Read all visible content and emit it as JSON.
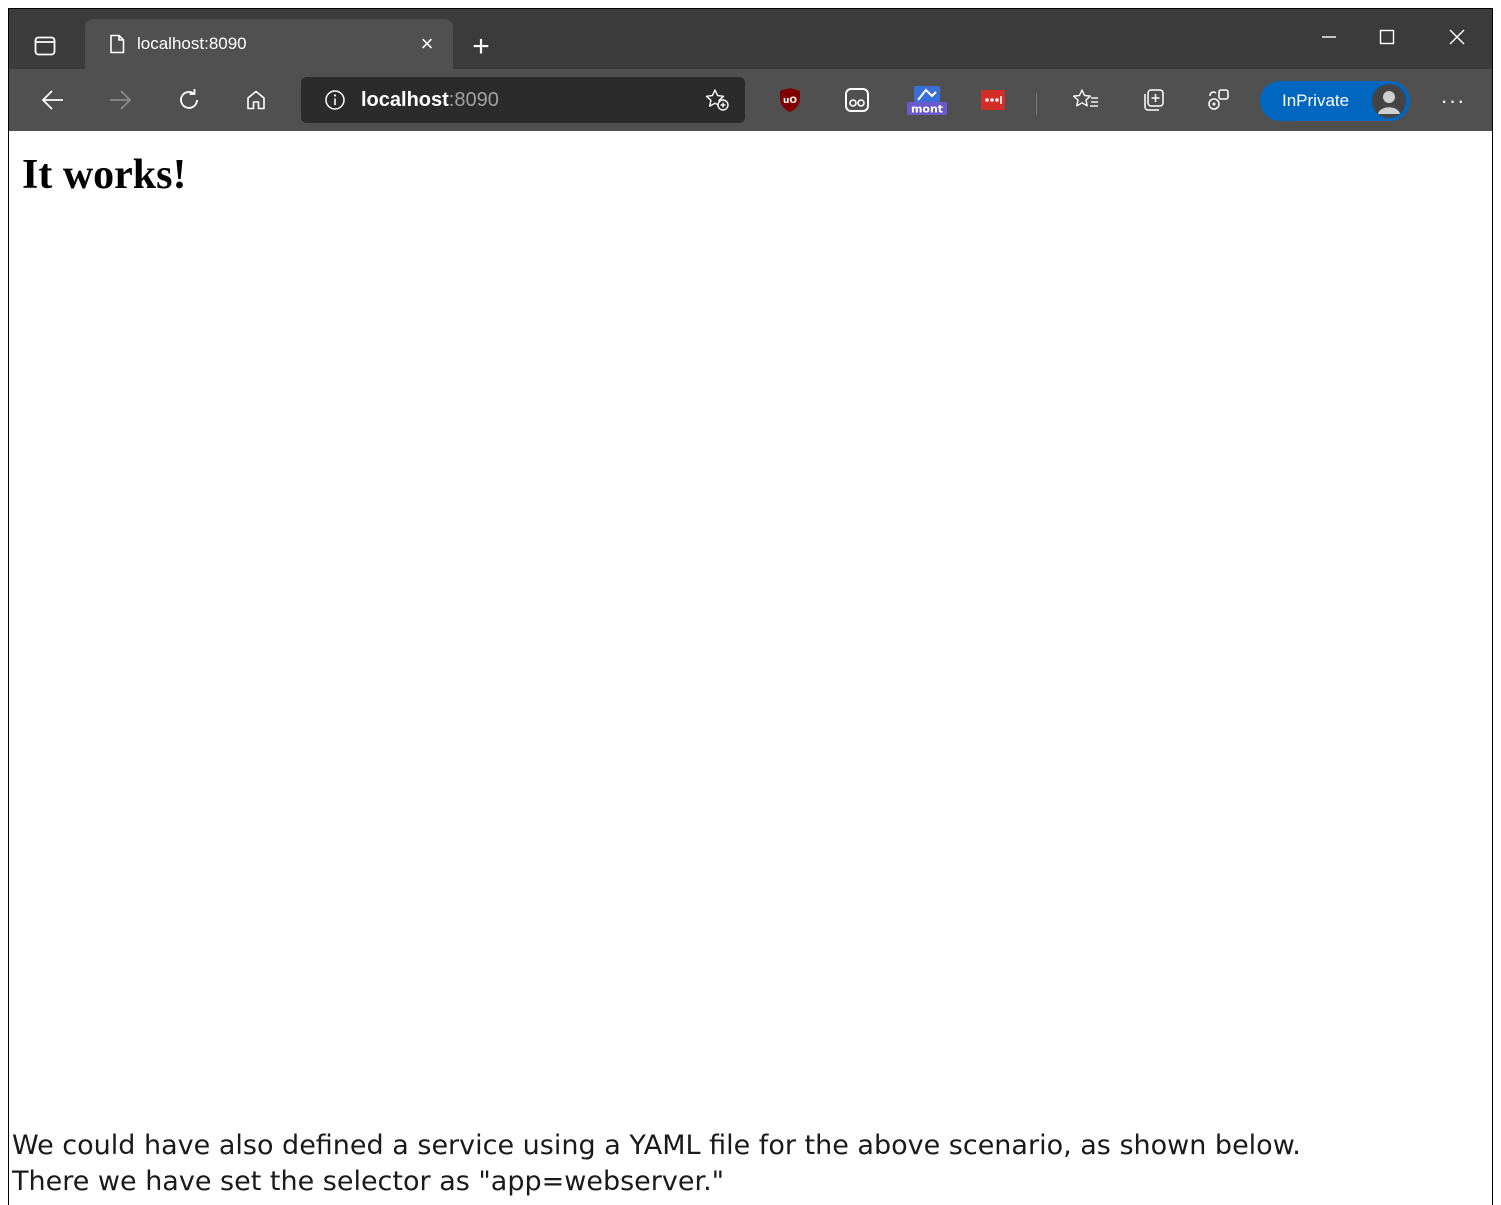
{
  "browser": {
    "tab": {
      "title": "localhost:8090",
      "close_glyph": "×"
    },
    "new_tab_glyph": "+",
    "window_controls": [
      "minimize-icon",
      "maximize-icon",
      "close-icon"
    ],
    "address_bar": {
      "host": "localhost",
      "port": ":8090"
    },
    "extensions": [
      "ublock-origin-icon",
      "extension-mask-icon",
      "month-calendar-extension-icon",
      "lastpass-icon"
    ],
    "profile": {
      "label": "InPrivate"
    },
    "more_glyph": "···",
    "colors": {
      "tabstrip": "#3b3b3b",
      "toolbar": "#505050",
      "address_bar": "#2b2b2b",
      "inprivate": "#0067c0"
    }
  },
  "page": {
    "heading": "It works!"
  },
  "caption": {
    "line1": "We could have also defined a service using a YAML file for the above scenario, as shown below.",
    "line2": "There we have set the selector as \"app=webserver.\""
  }
}
